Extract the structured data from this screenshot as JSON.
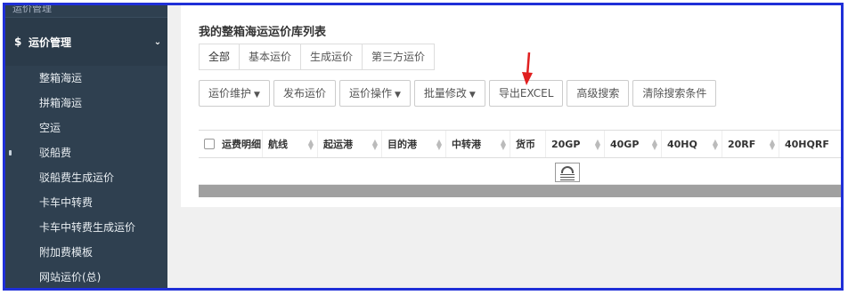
{
  "sidebar": {
    "top_cut_label": "运价管理",
    "section": {
      "icon": "dollar-icon",
      "label": "运价管理"
    },
    "items": [
      {
        "label": "整箱海运"
      },
      {
        "label": "拼箱海运"
      },
      {
        "label": "空运"
      },
      {
        "label": "驳船费"
      },
      {
        "label": "驳船费生成运价"
      },
      {
        "label": "卡车中转费"
      },
      {
        "label": "卡车中转费生成运价"
      },
      {
        "label": "附加费模板"
      },
      {
        "label": "网站运价(总)"
      }
    ]
  },
  "main": {
    "title": "我的整箱海运运价库列表",
    "tabs": [
      {
        "label": "全部"
      },
      {
        "label": "基本运价"
      },
      {
        "label": "生成运价"
      },
      {
        "label": "第三方运价"
      }
    ],
    "toolbar": [
      {
        "label": "运价维护",
        "dropdown": true
      },
      {
        "label": "发布运价",
        "dropdown": false
      },
      {
        "label": "运价操作",
        "dropdown": true
      },
      {
        "label": "批量修改",
        "dropdown": true
      },
      {
        "label": "导出EXCEL",
        "dropdown": false
      },
      {
        "label": "高级搜索",
        "dropdown": false
      },
      {
        "label": "清除搜索条件",
        "dropdown": false
      }
    ],
    "columns": [
      {
        "label": "运费明细",
        "sortable": false
      },
      {
        "label": "航线",
        "sortable": true
      },
      {
        "label": "起运港",
        "sortable": true
      },
      {
        "label": "目的港",
        "sortable": true
      },
      {
        "label": "中转港",
        "sortable": true
      },
      {
        "label": "货币",
        "sortable": false
      },
      {
        "label": "20GP",
        "sortable": true
      },
      {
        "label": "40GP",
        "sortable": true
      },
      {
        "label": "40HQ",
        "sortable": true
      },
      {
        "label": "20RF",
        "sortable": true
      },
      {
        "label": "40HQRF",
        "sortable": false
      }
    ]
  },
  "colors": {
    "sidebar_bg": "#2f4050",
    "frame_border": "#1f2fd8",
    "annotation_arrow": "#e02020"
  }
}
